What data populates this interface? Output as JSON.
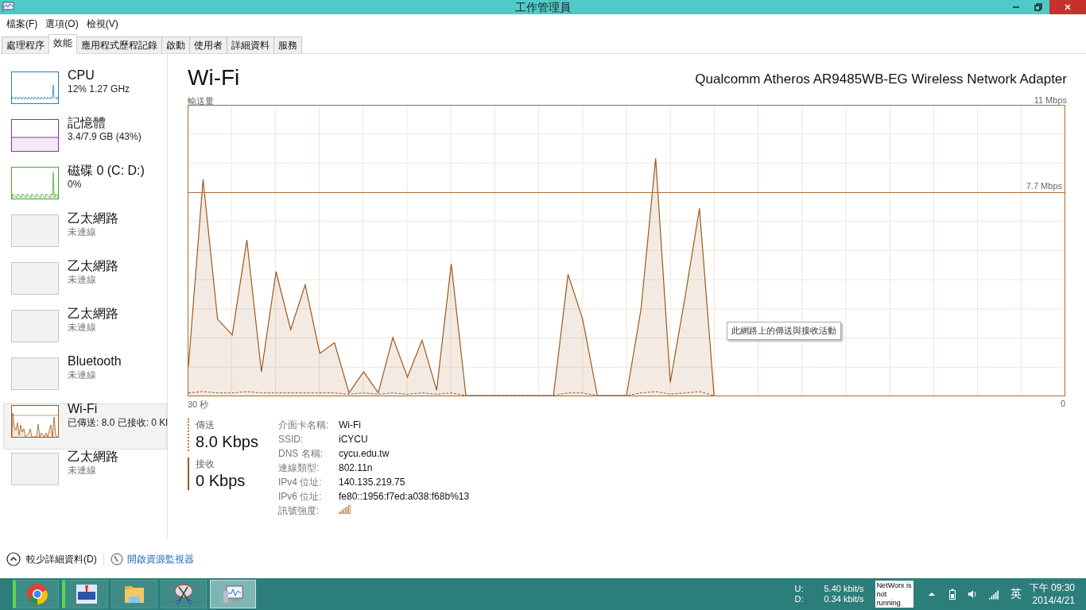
{
  "window": {
    "title": "工作管理員"
  },
  "menu": [
    "檔案(F)",
    "選項(O)",
    "檢視(V)"
  ],
  "tabs": [
    {
      "label": "處理程序",
      "selected": false
    },
    {
      "label": "效能",
      "selected": true
    },
    {
      "label": "應用程式歷程記錄",
      "selected": false
    },
    {
      "label": "啟動",
      "selected": false
    },
    {
      "label": "使用者",
      "selected": false
    },
    {
      "label": "詳細資料",
      "selected": false
    },
    {
      "label": "服務",
      "selected": false
    }
  ],
  "sidebar": {
    "items": [
      {
        "kind": "graph",
        "name": "CPU",
        "detail": "12% 1.27 GHz",
        "color": "#1f7fbf",
        "selected": false
      },
      {
        "kind": "graph",
        "name": "記憶體",
        "detail": "3.4/7.9 GB (43%)",
        "color": "#8b2fa0",
        "selected": false
      },
      {
        "kind": "graph",
        "name": "磁碟 0 (C: D:)",
        "detail": "0%",
        "color": "#4da32f",
        "selected": false
      },
      {
        "kind": "empty",
        "name": "乙太網路",
        "detail": "未連線",
        "selected": false
      },
      {
        "kind": "empty",
        "name": "乙太網路",
        "detail": "未連線",
        "selected": false
      },
      {
        "kind": "empty",
        "name": "乙太網路",
        "detail": "未連線",
        "selected": false
      },
      {
        "kind": "empty",
        "name": "Bluetooth",
        "detail": "未連線",
        "selected": false
      },
      {
        "kind": "graph",
        "name": "Wi-Fi",
        "detail": "已傳送: 8.0 已接收: 0 Kl",
        "color": "#a0581c",
        "selected": true
      },
      {
        "kind": "empty",
        "name": "乙太網路",
        "detail": "未連線",
        "selected": false
      }
    ]
  },
  "main": {
    "title": "Wi-Fi",
    "adapter": "Qualcomm Atheros AR9485WB-EG Wireless Network Adapter",
    "graph": {
      "axis_label": "輸送量",
      "max_label": "11 Mbps",
      "reference_label": "7.7 Mbps",
      "start_label": "30 秒",
      "end_label": "0"
    },
    "tooltip": "此網路上的傳送與接收活動",
    "stats": [
      {
        "label": "傳送",
        "value": "8.0 Kbps"
      },
      {
        "label": "接收",
        "value": "0 Kbps"
      }
    ],
    "details": [
      {
        "label": "介面卡名稱:",
        "kind": "text",
        "value": "Wi-Fi"
      },
      {
        "label": "SSID:",
        "kind": "text",
        "value": "iCYCU"
      },
      {
        "label": "DNS 名稱:",
        "kind": "text",
        "value": "cycu.edu.tw"
      },
      {
        "label": "連線類型:",
        "kind": "text",
        "value": "802.11n"
      },
      {
        "label": "IPv4 位址:",
        "kind": "text",
        "value": "140.135.219.75"
      },
      {
        "label": "IPv6 位址:",
        "kind": "text",
        "value": "fe80::1956:f7ed:a038:f68b%13"
      },
      {
        "label": "訊號強度:",
        "kind": "signal"
      }
    ]
  },
  "footer": {
    "fewer_details": "較少詳細資料(D)",
    "resource_monitor": "開啟資源監視器"
  },
  "taskbar": {
    "apps": [
      {
        "kind": "browser",
        "running": true,
        "selected": false
      },
      {
        "kind": "tile",
        "running": true,
        "selected": false
      },
      {
        "kind": "folder",
        "running": false,
        "selected": false
      },
      {
        "kind": "snip",
        "running": false,
        "selected": false
      },
      {
        "kind": "monitor",
        "running": false,
        "selected": true
      }
    ],
    "netrate": {
      "up_label": "U:",
      "up_value": "5.40 kbit/s",
      "down_label": "D:",
      "down_value": "0.34 kbit/s"
    },
    "networx": "NetWorx is not running",
    "ime": "英",
    "time": "下午 09:30",
    "date": "2014/4/21"
  }
}
